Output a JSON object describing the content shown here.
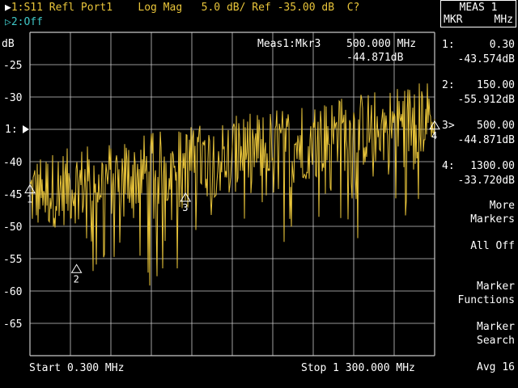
{
  "header": {
    "trace1": "1:S11 Refl Port1",
    "format": "Log Mag",
    "scale": "5.0 dB/",
    "ref": "Ref -35.00 dB",
    "flag": "C?",
    "trace2": "2:Off"
  },
  "plot": {
    "unit": "dB",
    "marker_readout_title": "Meas1:Mkr3",
    "marker_readout_freq": "500.000 MHz",
    "marker_readout_value": "-44.871dB",
    "ref_marker_label": "1:",
    "start_label": "Start 0.300 MHz",
    "stop_label": "Stop 1 300.000 MHz"
  },
  "chart_data": {
    "type": "line",
    "xlabel": "",
    "ylabel": "dB",
    "xlim": [
      0.3,
      1300
    ],
    "ylim": [
      -70,
      -20
    ],
    "yticks": [
      "-25",
      "-30",
      "-40",
      "-45",
      "-50",
      "-55",
      "-60",
      "-65"
    ],
    "grid": true,
    "series": [
      {
        "values_note": "",
        "color": "#e8c43a"
      }
    ],
    "markers": [
      {
        "id": "1",
        "x": 0.3,
        "y": -43.574
      },
      {
        "id": "2",
        "x": 150.0,
        "y": -55.912
      },
      {
        "id": "3",
        "x": 500.0,
        "y": -44.871
      },
      {
        "id": "4",
        "x": 1300.0,
        "y": -33.72
      }
    ]
  },
  "marker_table": {
    "box_title": "MEAS 1",
    "col1": "MKR",
    "col2": "MHz",
    "rows": [
      {
        "label": "1:",
        "freq": "0.30",
        "value": "-43.574dB"
      },
      {
        "label": "2:",
        "freq": "150.00",
        "value": "-55.912dB"
      },
      {
        "label": "3>",
        "freq": "500.00",
        "value": "-44.871dB"
      },
      {
        "label": "4:",
        "freq": "1300.00",
        "value": "-33.720dB"
      }
    ]
  },
  "softkeys": {
    "more_markers_l1": "More",
    "more_markers_l2": "Markers",
    "all_off": "All Off",
    "marker_functions_l1": "Marker",
    "marker_functions_l2": "Functions",
    "marker_search_l1": "Marker",
    "marker_search_l2": "Search",
    "avg": "Avg 16"
  },
  "colors": {
    "trace": "#e8c43a",
    "trace2": "#3fc7c7",
    "grid": "#c8c8c8",
    "text": "#ffffff"
  }
}
